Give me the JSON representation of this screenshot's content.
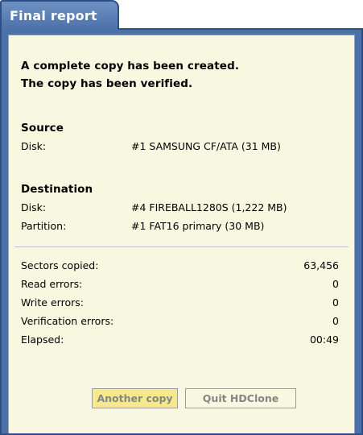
{
  "tab": {
    "title": "Final report"
  },
  "summary": {
    "line1": "A complete copy has been created.",
    "line2": "The copy has been verified."
  },
  "source": {
    "heading": "Source",
    "disk_label": "Disk:",
    "disk_value": "#1 SAMSUNG CF/ATA (31 MB)"
  },
  "destination": {
    "heading": "Destination",
    "disk_label": "Disk:",
    "disk_value": "#4 FIREBALL1280S (1,222 MB)",
    "partition_label": "Partition:",
    "partition_value": "#1 FAT16 primary (30 MB)"
  },
  "stats": [
    {
      "label": "Sectors copied:",
      "value": "63,456"
    },
    {
      "label": "Read errors:",
      "value": "0"
    },
    {
      "label": "Write errors:",
      "value": "0"
    },
    {
      "label": "Verification errors:",
      "value": "0"
    },
    {
      "label": "Elapsed:",
      "value": "00:49"
    }
  ],
  "buttons": {
    "another_copy": "Another copy",
    "quit": "Quit HDClone"
  },
  "colors": {
    "frame_blue": "#4c70a8",
    "panel_bg": "#f8f8e0",
    "primary_button_bg": "#f5e98c"
  }
}
